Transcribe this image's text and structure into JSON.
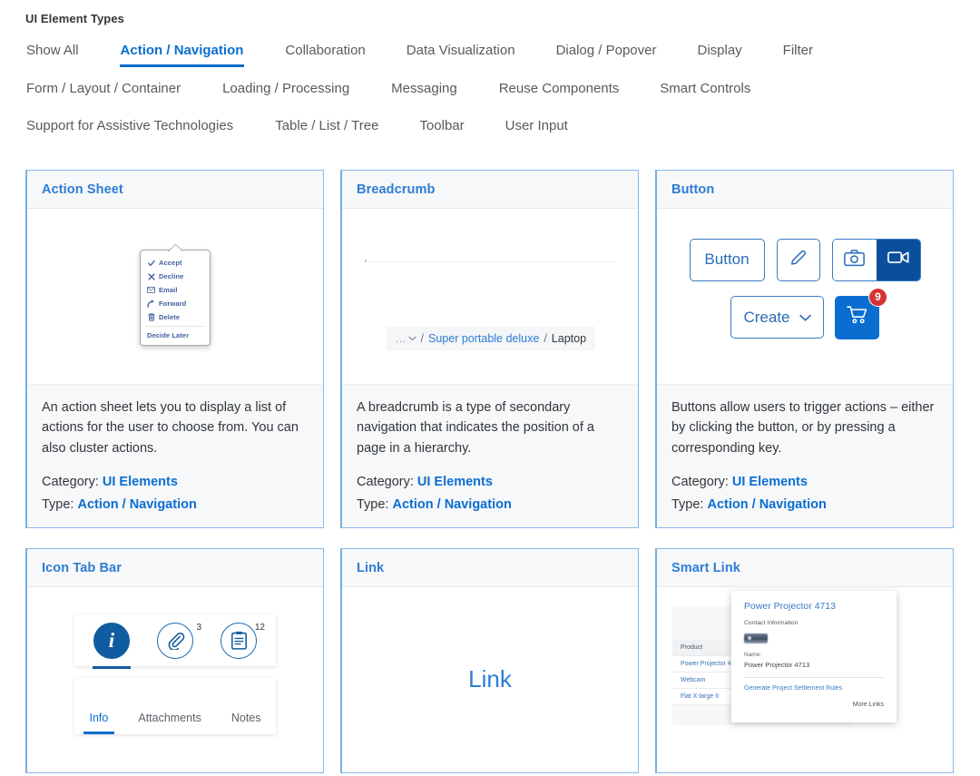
{
  "header": {
    "title": "UI Element Types"
  },
  "tabs": {
    "rows": [
      [
        {
          "label": "Show All",
          "selected": false
        },
        {
          "label": "Action / Navigation",
          "selected": true
        },
        {
          "label": "Collaboration",
          "selected": false
        },
        {
          "label": "Data Visualization",
          "selected": false
        },
        {
          "label": "Dialog / Popover",
          "selected": false
        },
        {
          "label": "Display",
          "selected": false
        },
        {
          "label": "Filter",
          "selected": false
        }
      ],
      [
        {
          "label": "Form / Layout / Container",
          "selected": false
        },
        {
          "label": "Loading / Processing",
          "selected": false
        },
        {
          "label": "Messaging",
          "selected": false
        },
        {
          "label": "Reuse Components",
          "selected": false
        },
        {
          "label": "Smart Controls",
          "selected": false
        }
      ],
      [
        {
          "label": "Support for Assistive Technologies",
          "selected": false
        },
        {
          "label": "Table / List / Tree",
          "selected": false
        },
        {
          "label": "Toolbar",
          "selected": false
        },
        {
          "label": "User Input",
          "selected": false
        }
      ]
    ]
  },
  "labels": {
    "category": "Category:",
    "type": "Type:"
  },
  "cards": {
    "action_sheet": {
      "title": "Action Sheet",
      "description": "An action sheet lets you to display a list of actions for the user to choose from. You can also cluster actions.",
      "category": "UI Elements",
      "type": "Action / Navigation",
      "items": [
        {
          "icon": "check-icon",
          "glyph": "✔",
          "label": "Accept"
        },
        {
          "icon": "close-icon",
          "glyph": "✖",
          "label": "Decline"
        },
        {
          "icon": "envelope-icon",
          "glyph": "✉",
          "label": "Email"
        },
        {
          "icon": "forward-arrow-icon",
          "glyph": "➦",
          "label": "Forward"
        },
        {
          "icon": "trash-icon",
          "glyph": "🗑",
          "label": "Delete"
        },
        {
          "icon": "",
          "glyph": "",
          "label": "Decide Later"
        }
      ]
    },
    "breadcrumb": {
      "title": "Breadcrumb",
      "description": "A breadcrumb is a type of secondary navigation that indicates the position of a page in a hierarchy.",
      "category": "UI Elements",
      "type": "Action / Navigation",
      "crumbs": {
        "ellipsis": "...",
        "sep1": "/",
        "link": "Super portable deluxe",
        "sep2": "/",
        "current": "Laptop"
      }
    },
    "button": {
      "title": "Button",
      "description": "Buttons allow users to trigger actions – either by clicking the button, or by pressing a corresponding key.",
      "category": "UI Elements",
      "type": "Action / Navigation",
      "button_label": "Button",
      "create_label": "Create",
      "cart_badge": "9"
    },
    "icon_tab_bar": {
      "title": "Icon Tab Bar",
      "description": "",
      "tabs": [
        {
          "icon": "info-icon",
          "count": "",
          "label": "Info",
          "active": true
        },
        {
          "icon": "paperclip-icon",
          "count": "3",
          "label": "Attachments",
          "active": false
        },
        {
          "icon": "clipboard-icon",
          "count": "12",
          "label": "Notes",
          "active": false
        }
      ]
    },
    "link": {
      "title": "Link",
      "link_text": "Link"
    },
    "smart_link": {
      "title": "Smart Link",
      "table": {
        "header": "Product",
        "rows": [
          "Power Projector 4713",
          "Webcam",
          "Flat X-large II"
        ]
      },
      "popup": {
        "title": "Power Projector 4713",
        "subtitle": "Contact Information",
        "name_label": "Name:",
        "name_value": "Power Projector 4713",
        "action": "Generate Project Settlement Rules",
        "more": "More Links"
      }
    }
  },
  "colors": {
    "accent": "#0a6ed1",
    "card_border": "#89b9ec",
    "card_title": "#2e7cd6",
    "badge_red": "#d63232",
    "dark_blue": "#0a4f9e"
  }
}
